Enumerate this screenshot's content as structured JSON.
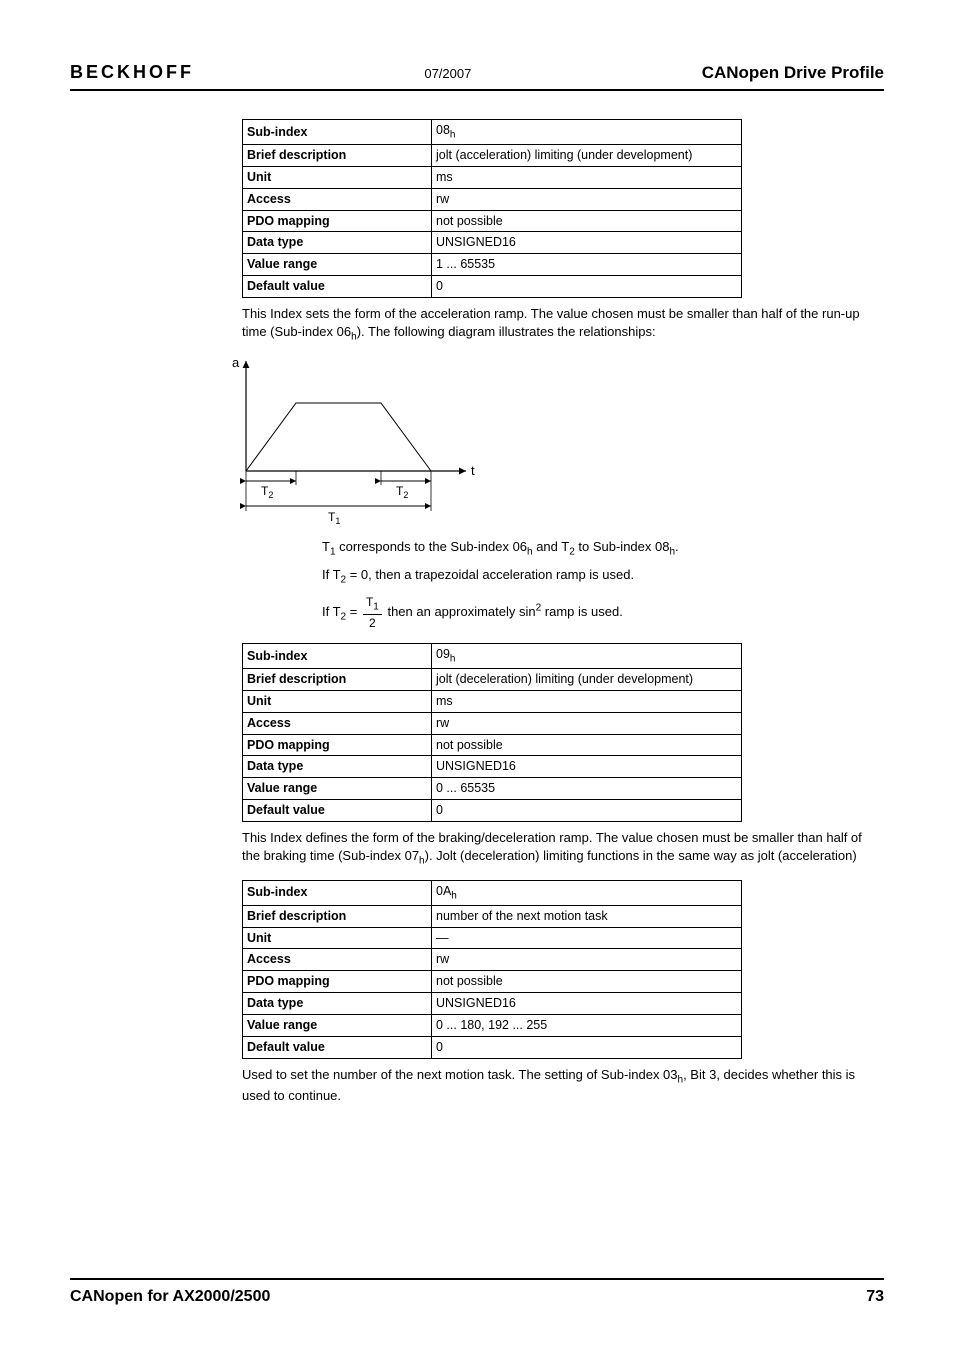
{
  "header": {
    "brand": "BECKHOFF",
    "date": "07/2007",
    "section": "CANopen Drive Profile"
  },
  "tables": {
    "t1": {
      "sub_index": "08",
      "sub_index_suffix": "h",
      "brief": "jolt (acceleration) limiting (under development)",
      "unit": "ms",
      "access": "rw",
      "pdo": "not possible",
      "dtype": "UNSIGNED16",
      "range": "1 ... 65535",
      "default": "0"
    },
    "t2": {
      "sub_index": "09",
      "sub_index_suffix": "h",
      "brief": "jolt (deceleration) limiting (under development)",
      "unit": "ms",
      "access": "rw",
      "pdo": "not possible",
      "dtype": "UNSIGNED16",
      "range": "0 ... 65535",
      "default": "0"
    },
    "t3": {
      "sub_index": "0A",
      "sub_index_suffix": "h",
      "brief": "number of the next motion task",
      "unit": "—",
      "access": "rw",
      "pdo": "not possible",
      "dtype": "UNSIGNED16",
      "range": "0 ... 180, 192 ... 255",
      "default": "0"
    }
  },
  "labels": {
    "sub_index": "Sub-index",
    "brief": "Brief description",
    "unit": "Unit",
    "access": "Access",
    "pdo": "PDO mapping",
    "dtype": "Data type",
    "range": "Value range",
    "default": "Default value"
  },
  "text": {
    "after_t1_a": "This Index sets the form of the acceleration ramp. The value chosen must be smaller than half of the run-up time (Sub-index 06",
    "after_t1_b": "). The following diagram illustrates the relationships:",
    "expl_line1_a": "T",
    "expl_line1_b": " corresponds to the Sub-index 06",
    "expl_line1_c": " and T",
    "expl_line1_d": " to Sub-index 08",
    "expl_line1_e": ".",
    "expl_line2_a": "If T",
    "expl_line2_b": " = 0, then a trapezoidal acceleration ramp is used.",
    "expl_line3_a": "If T",
    "expl_line3_b": " = ",
    "expl_line3_c": " then an approximately sin",
    "expl_line3_d": " ramp is used.",
    "after_t2_a": "This Index defines the form of the braking/deceleration ramp. The value chosen must be smaller than half of the braking time (Sub-index 07",
    "after_t2_b": "). Jolt (deceleration) limiting functions in the same way as jolt (acceleration)",
    "after_t3_a": "Used to set the number of the next motion task. The setting of Sub-index 03",
    "after_t3_b": ", Bit 3, decides whether this is used to continue."
  },
  "diagram": {
    "axis_y": "a",
    "axis_x": "t",
    "T1": "T",
    "T1sub": "1",
    "T2": "T",
    "T2sub": "2"
  },
  "frac": {
    "num": "T1",
    "den": "2"
  },
  "footer": {
    "title": "CANopen for AX2000/2500",
    "page": "73"
  }
}
